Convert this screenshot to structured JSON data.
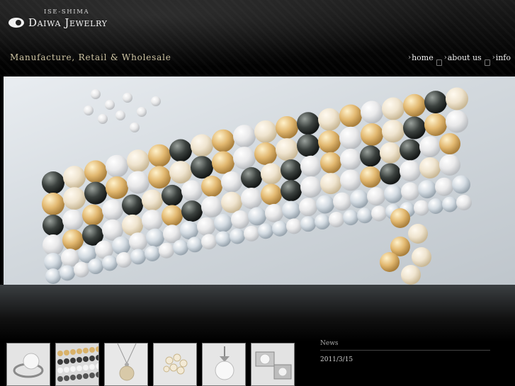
{
  "brand": {
    "top_text": "ISE-SHIMA",
    "name": "Daiwa Jewelry"
  },
  "tagline": "Manufacture, Retail & Wholesale",
  "nav": {
    "items": [
      {
        "arrow": "›",
        "label": "home"
      },
      {
        "arrow": "›",
        "label": "about us"
      },
      {
        "arrow": "›",
        "label": "info"
      }
    ]
  },
  "thumbnails": [
    {
      "name": "pearl-ring"
    },
    {
      "name": "pearl-strands"
    },
    {
      "name": "pearl-pendant"
    },
    {
      "name": "pearl-cluster-ring"
    },
    {
      "name": "pearl-drop-pendant"
    },
    {
      "name": "pearl-cufflinks"
    }
  ],
  "news": {
    "title": "News",
    "items": [
      {
        "date": "2011/3/15",
        "text": ""
      }
    ]
  },
  "colors": {
    "tagline": "#cfc5a4",
    "background": "#000000"
  }
}
